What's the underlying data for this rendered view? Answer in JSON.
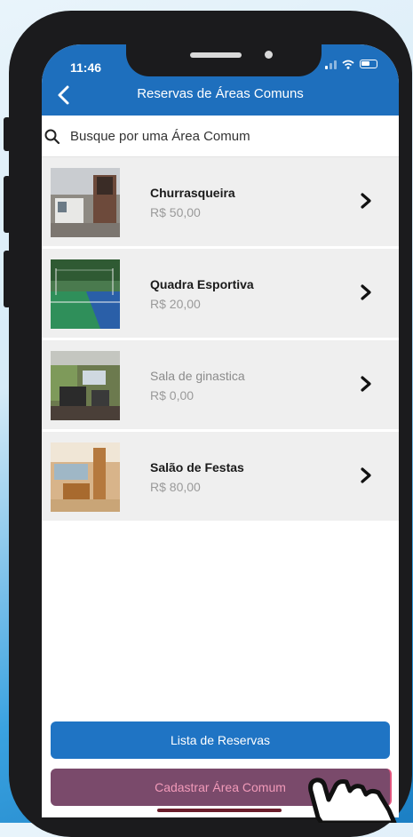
{
  "status_bar": {
    "time": "11:46"
  },
  "header": {
    "title": "Reservas de Áreas Comuns"
  },
  "search": {
    "placeholder": "Busque por uma Área Comum"
  },
  "areas": [
    {
      "name": "Churrasqueira",
      "price": "R$ 50,00"
    },
    {
      "name": "Quadra Esportiva",
      "price": "R$ 20,00"
    },
    {
      "name": "Sala de ginastica",
      "price": "R$ 0,00"
    },
    {
      "name": "Salão de Festas",
      "price": "R$ 80,00"
    }
  ],
  "buttons": {
    "list_label": "Lista de Reservas",
    "register_label": "Cadastrar Área Comum"
  },
  "colors": {
    "header": "#1e6fbd",
    "primary_button": "#1f74c4",
    "secondary_button": "#7a4a6b"
  },
  "icons": [
    "back-chevron-icon",
    "search-icon",
    "chevron-right-icon",
    "signal-icon",
    "wifi-icon",
    "battery-icon",
    "pointer-hand-icon"
  ]
}
